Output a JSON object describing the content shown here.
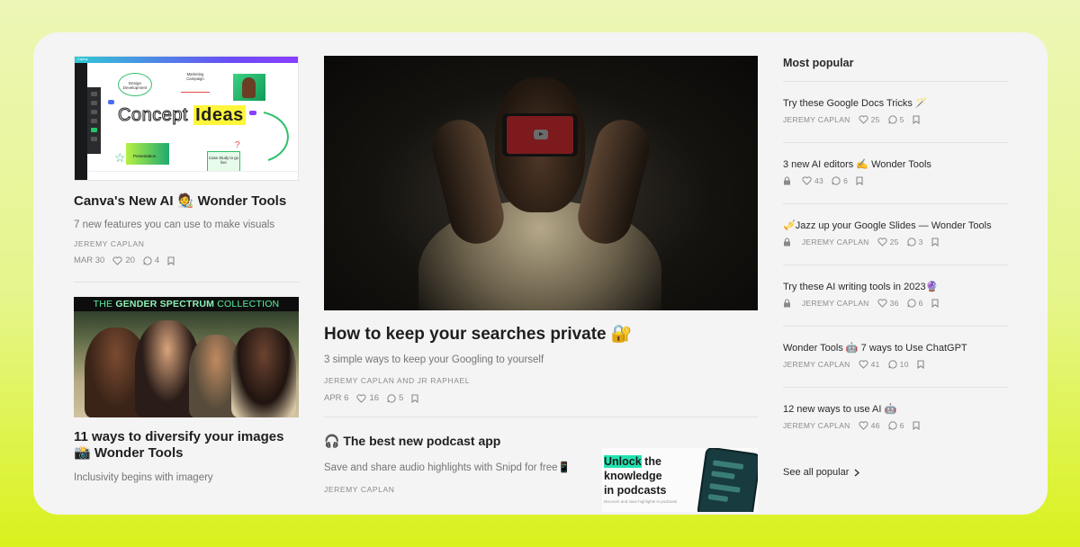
{
  "left": {
    "article1": {
      "thumb": {
        "canva_label": "Canva",
        "concept_outline": "Concept",
        "concept_highlight": "Ideas",
        "bubble1": "Design Development",
        "bubble2": "Marketing Campaign",
        "green_label": "Presentation",
        "box_label": "Case Study to go live"
      },
      "title": "Canva's New AI 🧑‍🎨 Wonder Tools",
      "subtitle": "7 new features you can use to make visuals",
      "author": "JEREMY CAPLAN",
      "date": "MAR 30",
      "likes": "20",
      "comments": "4"
    },
    "article2": {
      "banner_a": "THE ",
      "banner_b": "GENDER SPECTRUM",
      "banner_c": " COLLECTION",
      "title": "11 ways to diversify your images 📸 Wonder Tools",
      "subtitle": "Inclusivity begins with imagery"
    }
  },
  "middle": {
    "featured": {
      "title": "How to keep your searches private 🔐",
      "subtitle": "3 simple ways to keep your Googling to yourself",
      "author": "JEREMY CAPLAN AND JR RAPHAEL",
      "date": "APR 6",
      "likes": "16",
      "comments": "5"
    },
    "second": {
      "title": "🎧 The best new podcast app",
      "subtitle": "Save and share audio highlights with Snipd for free📱",
      "author": "JEREMY CAPLAN",
      "promo_highlight": "Unlock",
      "promo_line1_rest": " the",
      "promo_line2": "knowledge",
      "promo_line3": "in podcasts",
      "promo_small": "Discover and save highlights in podcasts"
    }
  },
  "right": {
    "heading": "Most popular",
    "items": [
      {
        "title": "Try these Google Docs Tricks 🪄",
        "author": "JEREMY CAPLAN",
        "likes": "25",
        "comments": "5",
        "locked": false
      },
      {
        "title": "3 new AI editors ✍️ Wonder Tools",
        "author": "",
        "likes": "43",
        "comments": "6",
        "locked": true
      },
      {
        "title": "🎺Jazz up your Google Slides — Wonder Tools",
        "author": "JEREMY CAPLAN",
        "likes": "25",
        "comments": "3",
        "locked": true
      },
      {
        "title": "Try these AI writing tools in 2023🔮",
        "author": "JEREMY CAPLAN",
        "likes": "36",
        "comments": "6",
        "locked": true
      },
      {
        "title": "Wonder Tools 🤖 7 ways to Use ChatGPT",
        "author": "JEREMY CAPLAN",
        "likes": "41",
        "comments": "10",
        "locked": false
      },
      {
        "title": "12 new ways to use AI 🤖",
        "author": "JEREMY CAPLAN",
        "likes": "46",
        "comments": "6",
        "locked": false
      }
    ],
    "see_all": "See all popular"
  },
  "colors": {
    "page_gradient_top": "#edf6b6",
    "page_gradient_bottom": "#d9f21c",
    "card": "#f4f4f4",
    "muted_text": "#8a8a8a",
    "promo_highlight": "#22e3b0"
  }
}
